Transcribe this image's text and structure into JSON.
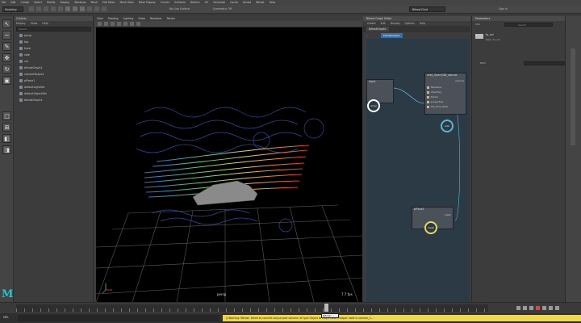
{
  "menubar": {
    "items": [
      "File",
      "Edit",
      "Create",
      "Select",
      "Modify",
      "Display",
      "Windows",
      "Mesh",
      "Edit Mesh",
      "Mesh Tools",
      "Mesh Display",
      "Curves",
      "Surfaces",
      "Deform",
      "UV",
      "Generate",
      "Cache",
      "Arnold",
      "Bifrost",
      "Help"
    ]
  },
  "statusline": {
    "mode": "Modeling",
    "workspace": "Bifrost Fluid",
    "no_live_surface": "No Live Surface",
    "symmetry": "Symmetry: Off",
    "sign_in": "Sign In"
  },
  "outliner": {
    "title": "Outliner",
    "menus": [
      "Display",
      "Show",
      "Help"
    ],
    "search_placeholder": "Search...",
    "items": [
      "persp",
      "top",
      "front",
      "side",
      "car",
      "bifrostGraph1",
      "volumeShape1",
      "pPlane1",
      "defaultLightSet",
      "defaultObjectSet",
      "bifrostGraph1"
    ]
  },
  "viewport": {
    "tabs": [
      "View",
      "Shading",
      "Lighting",
      "Show",
      "Renderer",
      "Panels"
    ],
    "camera_label": "persp",
    "fps_label": "7.7 fps"
  },
  "bifrost": {
    "title": "Bifrost Graph Editor",
    "menus": [
      "Create",
      "Edit",
      "Display",
      "Options",
      "Help"
    ],
    "tab_label": "bifrostGraph1",
    "breadcrumb": "bifrostGraph1",
    "nodes": {
      "input": {
        "title": "input",
        "badge": "array"
      },
      "volume": {
        "title": "read_OpenVDB_volume",
        "ports": [
          "filename",
          "directory",
          "frame",
          "properties",
          "file_time_field"
        ],
        "out_label": "volume",
        "badge": "volb"
      },
      "plane": {
        "title": "pPlane1",
        "out_label": "mesh",
        "badge": "mesh"
      }
    }
  },
  "params": {
    "title": "Parameters",
    "tab": "Info",
    "search_placeholder": "Search",
    "node_name": "to_vol",
    "type_label": "Type: to_vol",
    "field_label": "Path"
  },
  "timeline": {
    "playhead_frame": ""
  },
  "command": {
    "mel_label": "MEL",
    "warning": "// Warning: Bifrost: Failed to convert output port volume: of type Object to Maya mesh. Output node is volume_1..."
  },
  "tooltip": {
    "text": "Bifrost: ..."
  },
  "colors": {
    "accent": "#2fc0d0",
    "warning": "#f2d64a",
    "graph_bg": "#2b3a45"
  }
}
